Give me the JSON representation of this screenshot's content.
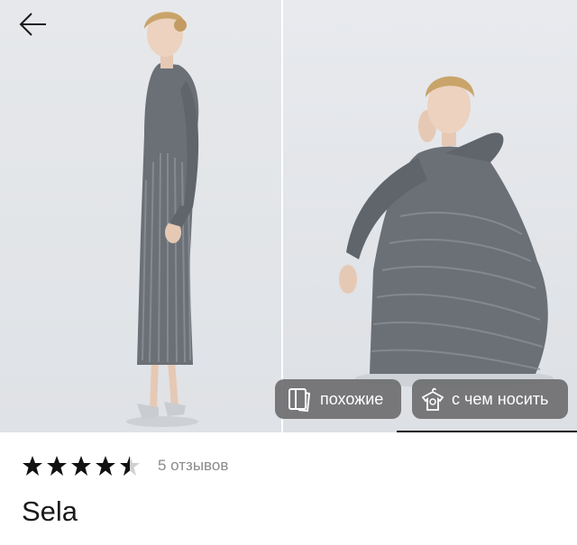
{
  "gallery": {
    "images": [
      {
        "alt": "woman standing in grey ribbed knit midi dress"
      },
      {
        "alt": "woman crouching in grey ribbed knit midi dress"
      }
    ],
    "active_index": 1,
    "image_count": 2
  },
  "actions": {
    "back_icon": "arrow-left-icon",
    "similar_label": "похожие",
    "similar_icon": "photo-cards-icon",
    "outfit_label": "с чем носить",
    "outfit_icon": "hanger-shirt-icon"
  },
  "rating": {
    "value": 4.5,
    "max": 5,
    "reviews_label": "5 отзывов"
  },
  "product": {
    "brand": "Sela"
  },
  "colors": {
    "chip_bg": "#6e6e70",
    "dress": "#6b7077",
    "background": "#e3e5e8",
    "text": "#1a1a1a",
    "muted": "#8a8a8a"
  }
}
